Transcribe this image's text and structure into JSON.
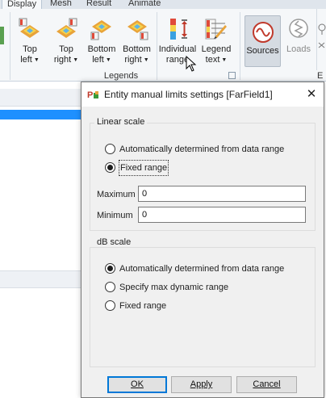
{
  "ribbon": {
    "tabs": [
      "Display",
      "Mesh",
      "Result",
      "Animate"
    ],
    "buttons": [
      {
        "line1": "Top",
        "line2": "left"
      },
      {
        "line1": "Top",
        "line2": "right"
      },
      {
        "line1": "Bottom",
        "line2": "left"
      },
      {
        "line1": "Bottom",
        "line2": "right"
      },
      {
        "line1": "Individual",
        "line2": "range"
      },
      {
        "line1": "Legend",
        "line2": "text"
      }
    ],
    "legends_group_label": "Legends",
    "sources_label": "Sources",
    "loads_label": "Loads",
    "edge_letter": "E"
  },
  "dialog": {
    "title": "Entity manual limits settings [FarField1]",
    "linear_scale": {
      "title": "Linear scale",
      "options": [
        "Automatically determined from data range",
        "Fixed range"
      ],
      "selected": 1,
      "maximum_label": "Maximum",
      "maximum_value": "0",
      "minimum_label": "Minimum",
      "minimum_value": "0"
    },
    "db_scale": {
      "title": "dB scale",
      "options": [
        "Automatically determined from data range",
        "Specify max dynamic range",
        "Fixed range"
      ],
      "selected": 0
    },
    "buttons": {
      "ok": "OK",
      "apply": "Apply",
      "cancel": "Cancel"
    }
  }
}
